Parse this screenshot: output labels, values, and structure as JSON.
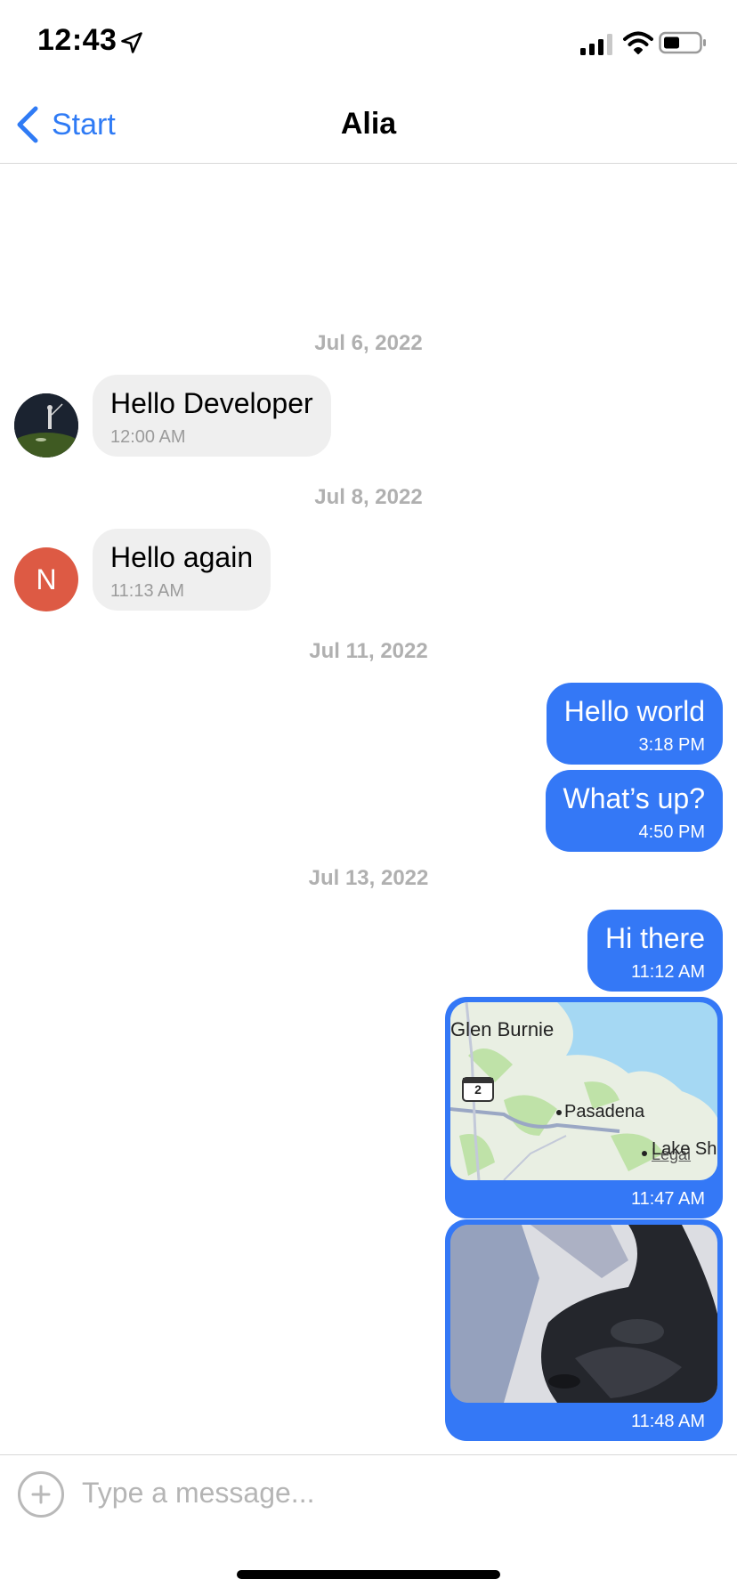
{
  "status_bar": {
    "time": "12:43",
    "icons": [
      "location-arrow-icon",
      "signal-icon",
      "wifi-icon",
      "battery-icon"
    ]
  },
  "nav": {
    "back_label": "Start",
    "title": "Alia"
  },
  "colors": {
    "accent": "#2f7bf5",
    "outgoing_bubble": "#3478f6",
    "incoming_bubble": "#efefef",
    "avatar_letter_bg": "#dd5a44",
    "date_text": "#b0b0b0"
  },
  "messages": {
    "date_1": "Jul 6, 2022",
    "m1": {
      "text": "Hello Developer",
      "time": "12:00 AM"
    },
    "date_2": "Jul 8, 2022",
    "m2": {
      "text": "Hello again",
      "time": "11:13 AM",
      "avatar_letter": "N"
    },
    "date_3": "Jul 11, 2022",
    "m3": {
      "text": "Hello world",
      "time": "3:18 PM"
    },
    "m4": {
      "text": "What’s up?",
      "time": "4:50 PM"
    },
    "date_4": "Jul 13, 2022",
    "m5": {
      "text": "Hi there",
      "time": "11:12 AM"
    },
    "m6": {
      "time": "11:47 AM",
      "map_labels": {
        "city_1": "Glen Burnie",
        "city_2": "Pasadena",
        "city_3": "Lake Sh",
        "route": "2",
        "legal": "Legal"
      }
    },
    "m7": {
      "time": "11:48 AM"
    }
  },
  "input": {
    "placeholder": "Type a message..."
  }
}
